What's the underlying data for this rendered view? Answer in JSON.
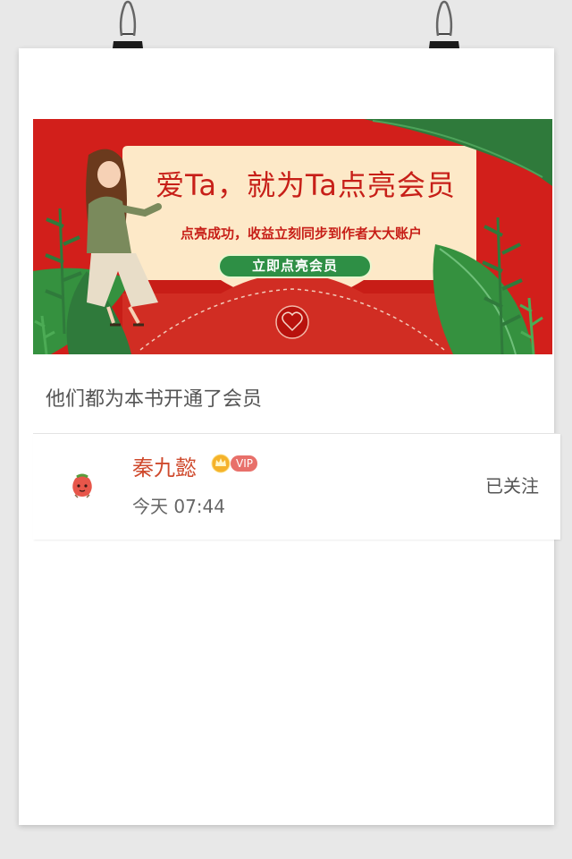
{
  "banner": {
    "title": "爱Ta，就为Ta点亮会员",
    "subtitle": "点亮成功，收益立刻同步到作者大大账户",
    "button_label": "立即点亮会员"
  },
  "section": {
    "title": "他们都为本书开通了会员"
  },
  "members": [
    {
      "name": "秦九懿",
      "badge": "VIP",
      "time": "今天 07:44",
      "follow_status": "已关注"
    }
  ],
  "colors": {
    "banner_red": "#d21f1b",
    "banner_cream": "#fde9c8",
    "button_green": "#2e8f45",
    "name_red": "#cf4a2d",
    "vip_pink": "#e8706a"
  }
}
